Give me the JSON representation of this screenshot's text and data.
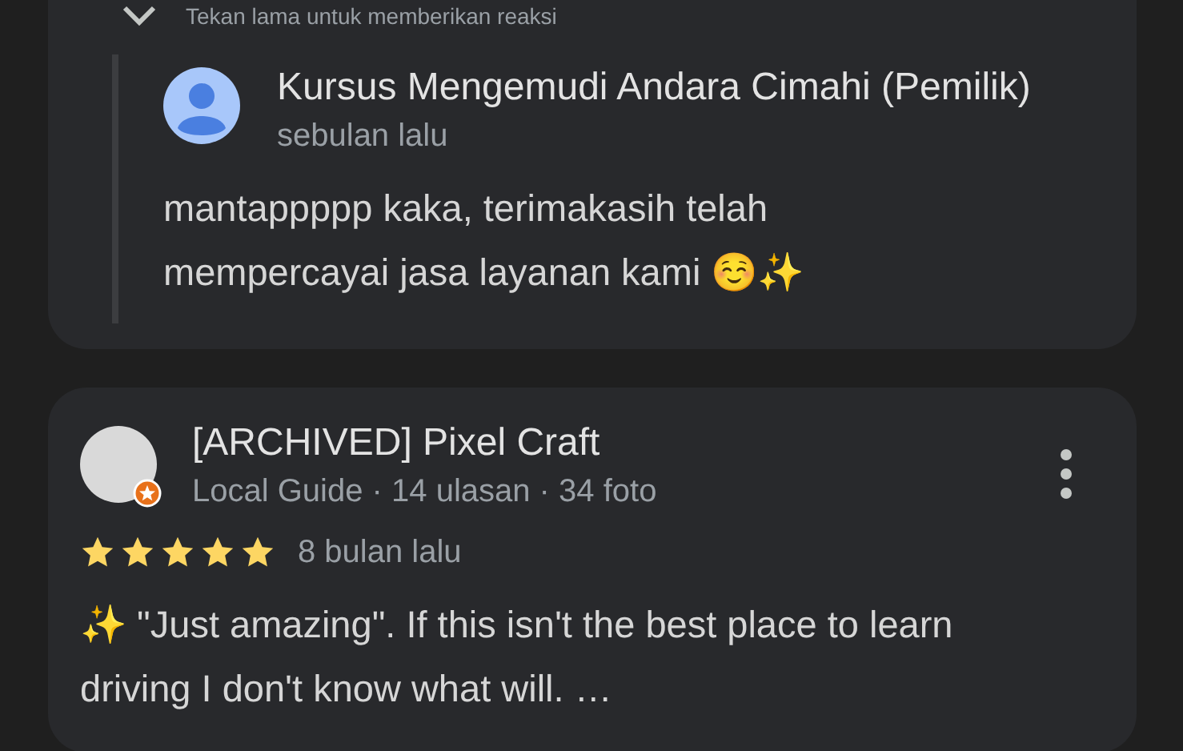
{
  "reaction_hint": "Tekan lama untuk memberikan reaksi",
  "owner_reply": {
    "author": "Kursus Mengemudi Andara Cimahi (Pemilik)",
    "time": "sebulan lalu",
    "text": "mantappppp kaka, terimakasih telah mempercayai jasa layanan kami ☺️✨"
  },
  "review": {
    "author": "[ARCHIVED] Pixel Craft",
    "meta": "Local Guide · 14 ulasan · 34 foto",
    "stars": 5,
    "time": "8 bulan lalu",
    "text": "✨ \"Just amazing\". If this isn't the best place to learn driving I don't know what will. …"
  }
}
